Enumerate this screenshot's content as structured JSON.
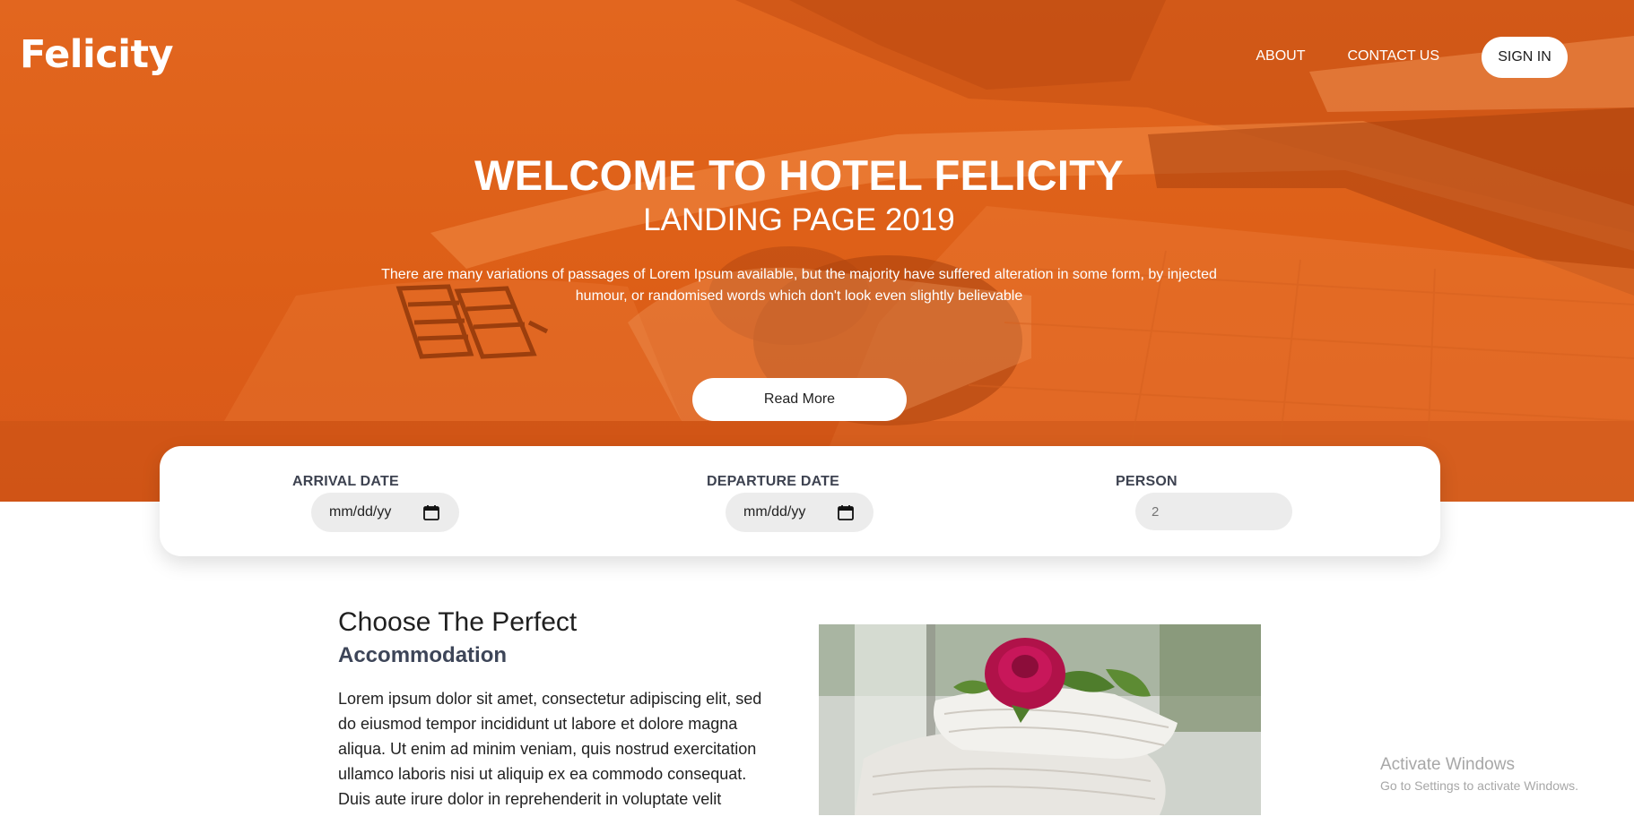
{
  "header": {
    "brand": "Felicity",
    "nav": {
      "about": "ABOUT",
      "contact": "CONTACT US",
      "signin": "SIGN IN"
    }
  },
  "hero": {
    "title": "WELCOME TO HOTEL FELICITY",
    "subtitle": "LANDING PAGE 2019",
    "text": "There are many variations of passages of Lorem Ipsum available, but the majority have suffered alteration in some form, by injected humour, or randomised words which don't look even slightly believable",
    "button": "Read More"
  },
  "booking": {
    "arrival_label": "ARRIVAL DATE",
    "arrival_value": "mm/dd/yy",
    "departure_label": "DEPARTURE DATE",
    "departure_value": "mm/dd/yy",
    "person_label": "PERSON",
    "person_placeholder": "2"
  },
  "section": {
    "title": "Choose The Perfect",
    "subtitle": "Accommodation",
    "body": "Lorem ipsum dolor sit amet, consectetur adipiscing elit, sed do eiusmod tempor incididunt ut labore et dolore magna aliqua. Ut enim ad minim veniam, quis nostrud exercitation ullamco laboris nisi ut aliquip ex ea commodo consequat. Duis aute irure dolor in reprehenderit in voluptate velit"
  },
  "watermark": {
    "title": "Activate Windows",
    "subtitle": "Go to Settings to activate Windows."
  },
  "colors": {
    "accent": "#e1641c",
    "hero_overlay": "#dd5f17",
    "white": "#ffffff"
  },
  "icons": [
    "calendar-icon"
  ]
}
